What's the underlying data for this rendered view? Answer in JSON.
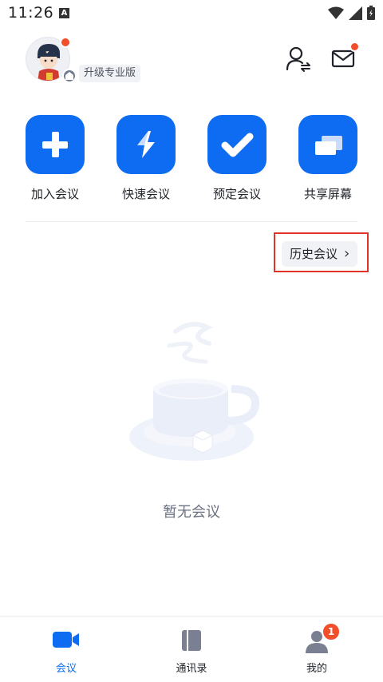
{
  "status_bar": {
    "time": "11:26",
    "notification_icon_letter": "A",
    "icons": [
      "wifi-icon",
      "cellular-signal-icon",
      "battery-icon"
    ]
  },
  "profile": {
    "avatar_has_notification": true,
    "upgrade_label": "升级专业版"
  },
  "header_icons": {
    "contacts_switch": "user-switch-icon",
    "inbox": "mail-icon",
    "inbox_has_notification": true
  },
  "quick_actions": [
    {
      "label": "加入会议",
      "icon": "plus-icon"
    },
    {
      "label": "快速会议",
      "icon": "lightning-icon"
    },
    {
      "label": "预定会议",
      "icon": "check-icon"
    },
    {
      "label": "共享屏幕",
      "icon": "share-screen-icon"
    }
  ],
  "history": {
    "label": "历史会议",
    "chevron": "›"
  },
  "empty_state": {
    "text": "暂无会议",
    "icon": "empty-cup-icon"
  },
  "tabbar": {
    "tabs": [
      {
        "label": "会议",
        "icon": "video-camera-icon",
        "active": true
      },
      {
        "label": "通讯录",
        "icon": "contacts-book-icon",
        "active": false
      },
      {
        "label": "我的",
        "icon": "person-icon",
        "active": false,
        "badge": "1"
      }
    ]
  },
  "colors": {
    "primary": "#0e6cf2",
    "notification": "#f24e2a",
    "highlight_outline": "#e03327"
  }
}
